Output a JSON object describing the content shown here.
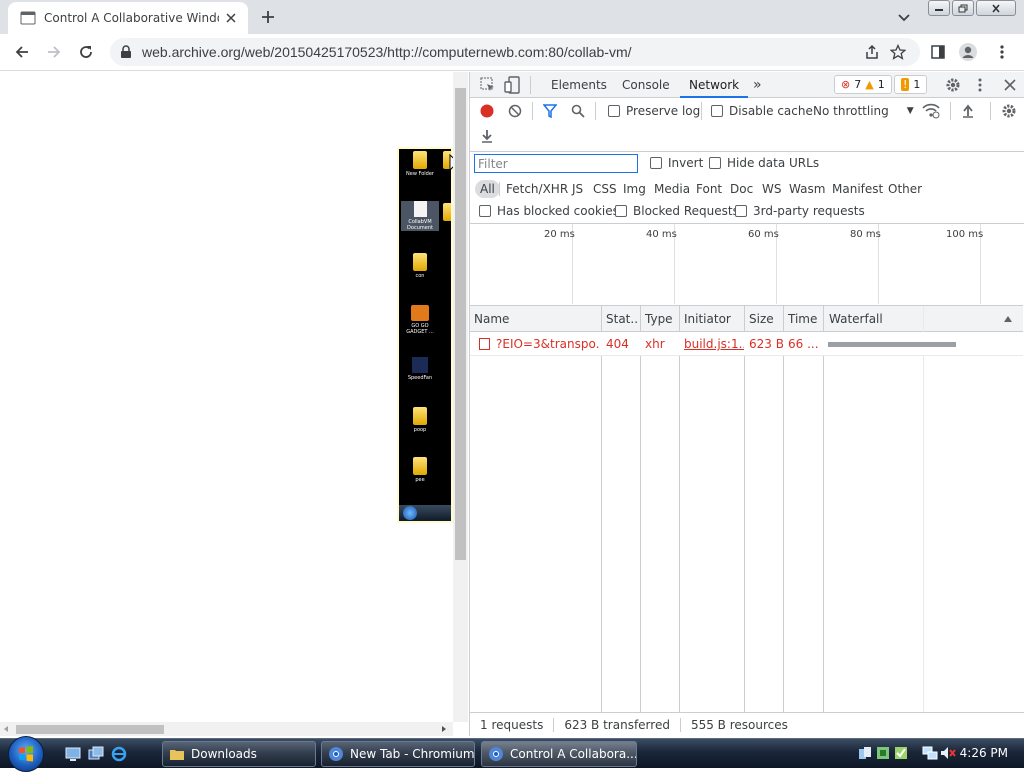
{
  "browser": {
    "tab_title": "Control A Collaborative Windows",
    "url": "web.archive.org/web/20150425170523/http://computernewb.com:80/collab-vm/"
  },
  "vm_desktop": {
    "icons": [
      "New Folder",
      "CollabVM Document",
      "con",
      "GO GO GADGET ...",
      "SpeedFan",
      "poop",
      "pee"
    ]
  },
  "devtools": {
    "tabs": [
      "Elements",
      "Console",
      "Network"
    ],
    "errors": "7",
    "warnings": "1",
    "issues": "1",
    "preserve_log": "Preserve log",
    "disable_cache": "Disable cache",
    "throttling": "No throttling",
    "filter_placeholder": "Filter",
    "invert": "Invert",
    "hide_data_urls": "Hide data URLs",
    "types": [
      "All",
      "Fetch/XHR",
      "JS",
      "CSS",
      "Img",
      "Media",
      "Font",
      "Doc",
      "WS",
      "Wasm",
      "Manifest",
      "Other"
    ],
    "has_blocked_cookies": "Has blocked cookies",
    "blocked_requests": "Blocked Requests",
    "third_party": "3rd-party requests",
    "timeline_labels": [
      "20 ms",
      "40 ms",
      "60 ms",
      "80 ms",
      "100 ms"
    ],
    "columns": [
      "Name",
      "Stat..",
      "Type",
      "Initiator",
      "Size",
      "Time",
      "Waterfall"
    ],
    "rows": [
      {
        "name": "?EIO=3&transpo...",
        "status": "404",
        "type": "xhr",
        "initiator": "build.js:1...",
        "size": "623 B",
        "time": "66 ..."
      }
    ],
    "status_bar": [
      "1 requests",
      "623 B transferred",
      "555 B resources"
    ]
  },
  "taskbar": {
    "buttons": [
      "Downloads",
      "New Tab - Chromium",
      "Control A Collabora..."
    ],
    "clock": "4:26 PM"
  },
  "colors": {
    "accent": "#1a73e8",
    "error": "#d93025",
    "record": "#d93025"
  }
}
